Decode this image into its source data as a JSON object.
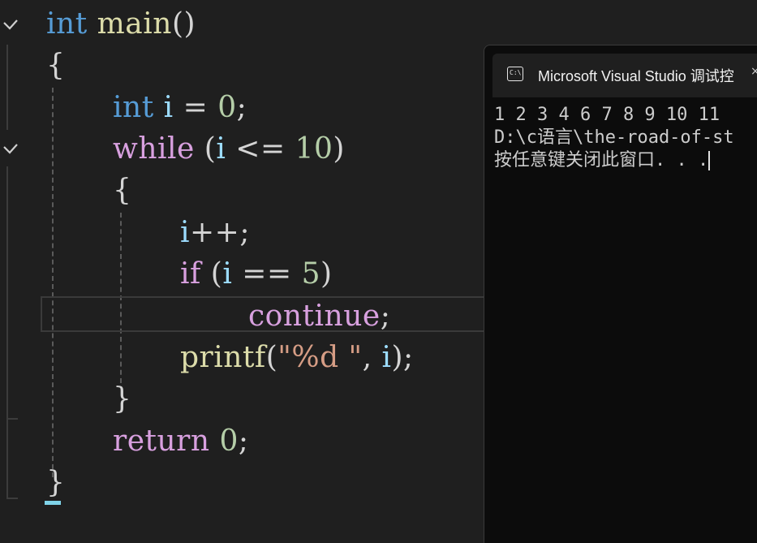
{
  "editor": {
    "lines": {
      "l1_kw": "int",
      "l1_fn": "main",
      "l1_p": "()",
      "l2": "{",
      "l3_kw": "int",
      "l3_var": "i",
      "l3_op": " = ",
      "l3_num": "0",
      "l3_end": ";",
      "l4_kw": "while",
      "l4_p1": " (",
      "l4_var": "i",
      "l4_op": " <= ",
      "l4_num": "10",
      "l4_p2": ")",
      "l5": "{",
      "l6_var": "i",
      "l6_rest": "++;",
      "l7_kw": "if",
      "l7_p1": " (",
      "l7_var": "i",
      "l7_op": " == ",
      "l7_num": "5",
      "l7_p2": ")",
      "l8_kw": "continue",
      "l8_end": ";",
      "l9_fn": "printf",
      "l9_p1": "(",
      "l9_str": "\"%d \"",
      "l9_comma": ", ",
      "l9_var": "i",
      "l9_p2": ");",
      "l10": "}",
      "l11_kw": "return",
      "l11_sp": " ",
      "l11_num": "0",
      "l11_end": ";",
      "l12": "}"
    }
  },
  "console": {
    "tab_title": "Microsoft Visual Studio 调试控",
    "tab_close": "×",
    "icon_text": "C:\\",
    "output": [
      "1 2 3 4 6 7 8 9 10 11",
      "D:\\c语言\\the-road-of-st",
      "按任意键关闭此窗口. . ."
    ]
  },
  "colors": {
    "keyword": "#569cd6",
    "control": "#d8a0df",
    "function": "#dcdcaa",
    "variable": "#9cdcfe",
    "number": "#b5cea8",
    "string": "#d69d85"
  }
}
